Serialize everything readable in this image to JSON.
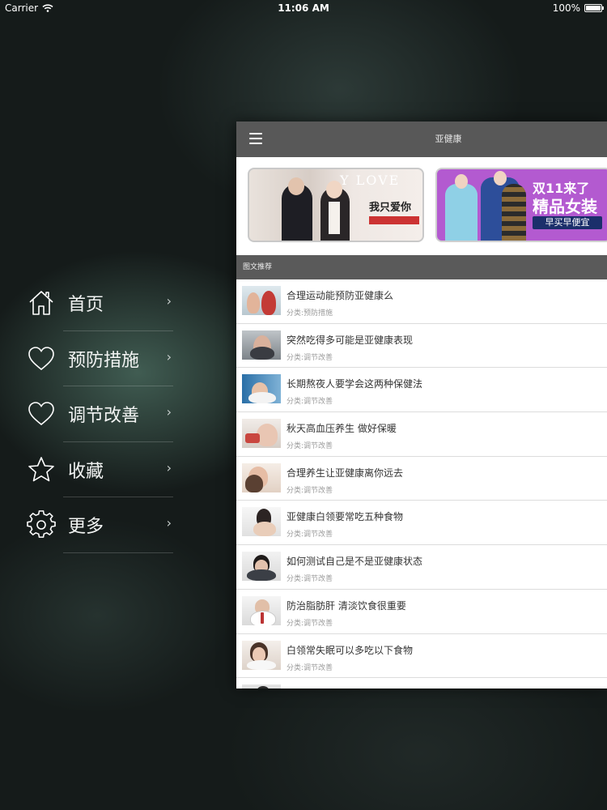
{
  "status": {
    "carrier": "Carrier",
    "time": "11:06 AM",
    "battery": "100%",
    "battery_level": 1.0
  },
  "menu": [
    {
      "label": "首页",
      "icon": "home-icon"
    },
    {
      "label": "预防措施",
      "icon": "heart-icon"
    },
    {
      "label": "调节改善",
      "icon": "heart-icon"
    },
    {
      "label": "收藏",
      "icon": "star-icon"
    },
    {
      "label": "更多",
      "icon": "gear-icon"
    }
  ],
  "menu_chevron": "›",
  "nav": {
    "title": "亚健康"
  },
  "banners": [
    {
      "heading": "Y LOVE",
      "text": "我只爱你",
      "tag": ""
    },
    {
      "heading": "双11来了",
      "text": "精品女装",
      "tag": "早买早便宜"
    }
  ],
  "section": {
    "title": "图文推荐"
  },
  "articles": [
    {
      "title": "合理运动能预防亚健康么",
      "category": "分类:预防措施"
    },
    {
      "title": "突然吃得多可能是亚健康表现",
      "category": "分类:调节改善"
    },
    {
      "title": "长期熬夜人要学会这两种保健法",
      "category": "分类:调节改善"
    },
    {
      "title": "秋天高血压养生 做好保暖",
      "category": "分类:调节改善"
    },
    {
      "title": "合理养生让亚健康离你远去",
      "category": "分类:调节改善"
    },
    {
      "title": "亚健康白领要常吃五种食物",
      "category": "分类:调节改善"
    },
    {
      "title": "如何测试自己是不是亚健康状态",
      "category": "分类:调节改善"
    },
    {
      "title": "防治脂肪肝 清淡饮食很重要",
      "category": "分类:调节改善"
    },
    {
      "title": "白领常失眠可以多吃以下食物",
      "category": "分类:调节改善"
    }
  ]
}
